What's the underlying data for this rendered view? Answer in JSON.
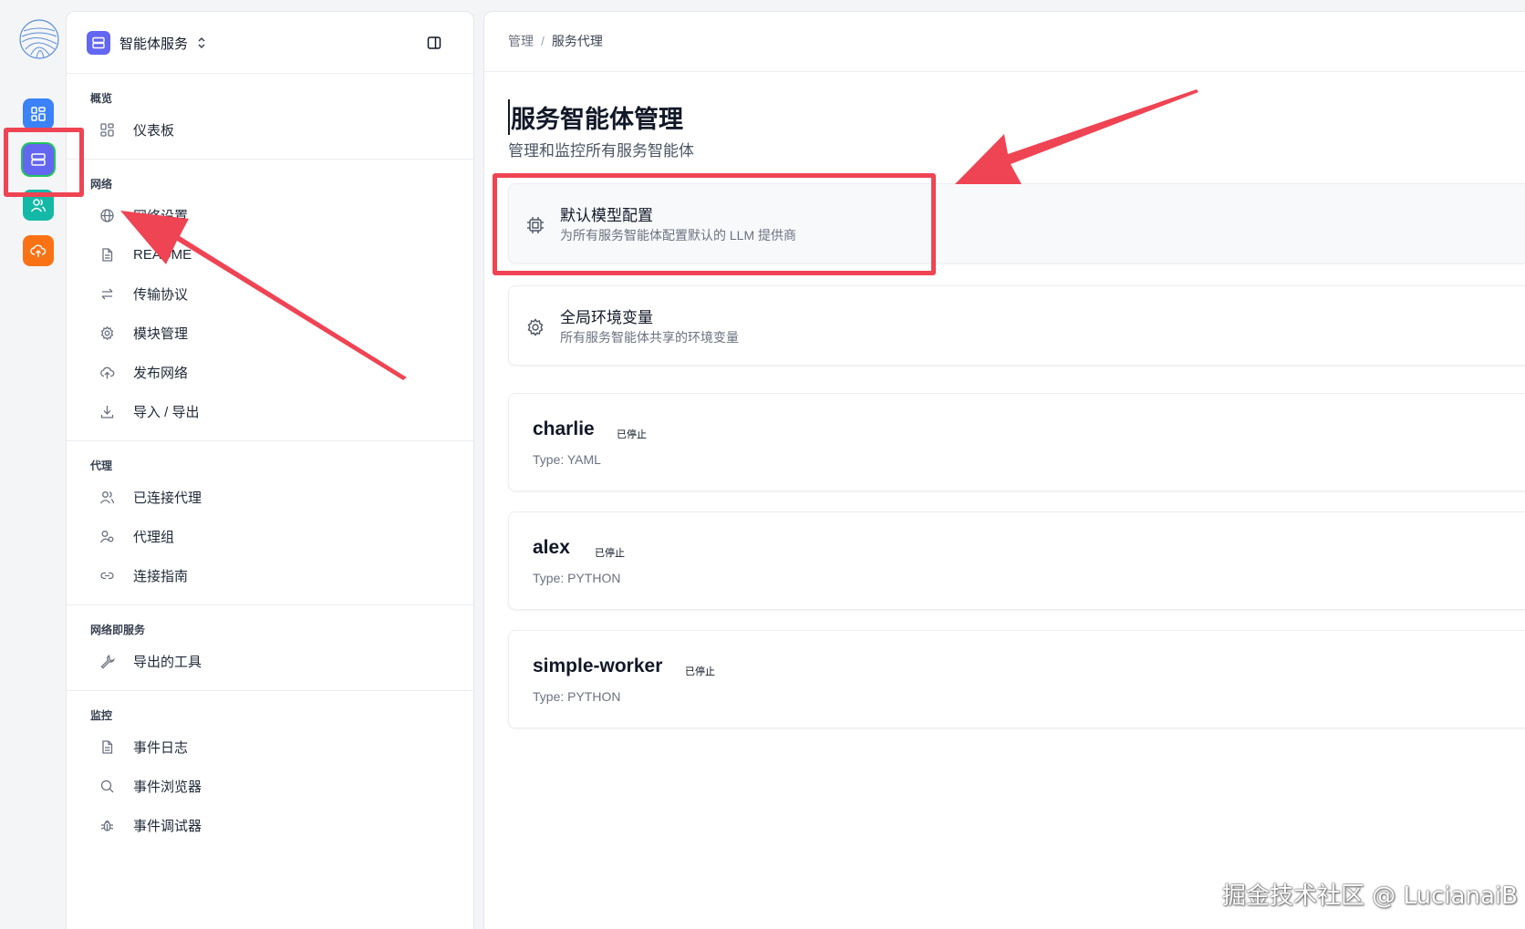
{
  "rail": {
    "items": [
      {
        "name": "dashboard",
        "color": "#3b82f6"
      },
      {
        "name": "agents",
        "color": "#6366f1"
      },
      {
        "name": "users",
        "color": "#14b8a6"
      },
      {
        "name": "publish",
        "color": "#f97316"
      }
    ]
  },
  "sidebar": {
    "app_label": "智能体服务",
    "sections": [
      {
        "title": "概览",
        "items": [
          {
            "label": "仪表板",
            "icon": "grid-icon"
          }
        ]
      },
      {
        "title": "网络",
        "items": [
          {
            "label": "网络设置",
            "icon": "globe-icon"
          },
          {
            "label": "README",
            "icon": "document-icon"
          },
          {
            "label": "传输协议",
            "icon": "arrows-icon"
          },
          {
            "label": "模块管理",
            "icon": "gear-icon"
          },
          {
            "label": "发布网络",
            "icon": "cloud-upload-icon"
          },
          {
            "label": "导入 / 导出",
            "icon": "download-icon"
          }
        ]
      },
      {
        "title": "代理",
        "items": [
          {
            "label": "已连接代理",
            "icon": "users-icon"
          },
          {
            "label": "代理组",
            "icon": "user-group-icon"
          },
          {
            "label": "连接指南",
            "icon": "link-icon"
          }
        ]
      },
      {
        "title": "网络即服务",
        "items": [
          {
            "label": "导出的工具",
            "icon": "wrench-icon"
          }
        ]
      },
      {
        "title": "监控",
        "items": [
          {
            "label": "事件日志",
            "icon": "document-icon"
          },
          {
            "label": "事件浏览器",
            "icon": "search-icon"
          },
          {
            "label": "事件调试器",
            "icon": "bug-icon"
          }
        ]
      }
    ]
  },
  "breadcrumb": {
    "root": "管理",
    "sep": "/",
    "current": "服务代理"
  },
  "page": {
    "title": "服务智能体管理",
    "subtitle": "管理和监控所有服务智能体"
  },
  "config_cards": [
    {
      "title": "默认模型配置",
      "desc": "为所有服务智能体配置默认的 LLM 提供商",
      "icon": "cpu-icon"
    },
    {
      "title": "全局环境变量",
      "desc": "所有服务智能体共享的环境变量",
      "icon": "gear-icon"
    }
  ],
  "agents": [
    {
      "name": "charlie",
      "status": "已停止",
      "type": "Type: YAML"
    },
    {
      "name": "alex",
      "status": "已停止",
      "type": "Type: PYTHON"
    },
    {
      "name": "simple-worker",
      "status": "已停止",
      "type": "Type: PYTHON"
    }
  ],
  "annotation_color": "#ef4453",
  "watermark": "掘金技术社区 @ LucianaiB"
}
